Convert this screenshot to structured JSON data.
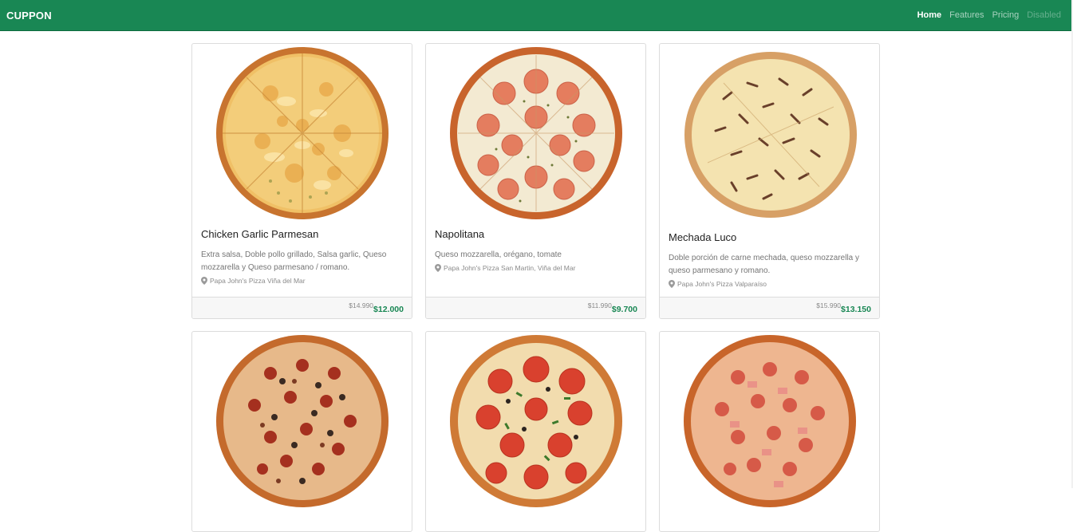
{
  "navbar": {
    "brand": "CUPPON",
    "links": [
      {
        "label": "Home",
        "state": "active"
      },
      {
        "label": "Features",
        "state": "normal"
      },
      {
        "label": "Pricing",
        "state": "normal"
      },
      {
        "label": "Disabled",
        "state": "disabled"
      }
    ]
  },
  "colors": {
    "navbar": "#198754",
    "price": "#198754"
  },
  "products": [
    {
      "title": "Chicken Garlic Parmesan",
      "description": "Extra salsa, Doble pollo grillado, Salsa garlic, Queso mozzarella y Queso parmesano / romano.",
      "location": "Papa John's Pizza Viña del Mar",
      "old_price": "$14.990",
      "price": "$12.000",
      "image": "pizza-chicken-garlic-parmesan"
    },
    {
      "title": "Napolitana",
      "description": "Queso mozzarella, orégano, tomate",
      "location": "Papa John's Pizza San Martin, Viña del Mar",
      "old_price": "$11.990",
      "price": "$9.700",
      "image": "pizza-napolitana"
    },
    {
      "title": "Mechada Luco",
      "description": "Doble porción de carne mechada, queso mozzarella y queso parmesano y romano.",
      "location": "Papa John's Pizza Valparaíso",
      "old_price": "$15.990",
      "price": "$13.150",
      "image": "pizza-mechada-luco"
    },
    {
      "image": "pizza-meat-mushroom"
    },
    {
      "image": "pizza-pepperoni-peppers"
    },
    {
      "image": "pizza-ham-pepperoni"
    }
  ]
}
